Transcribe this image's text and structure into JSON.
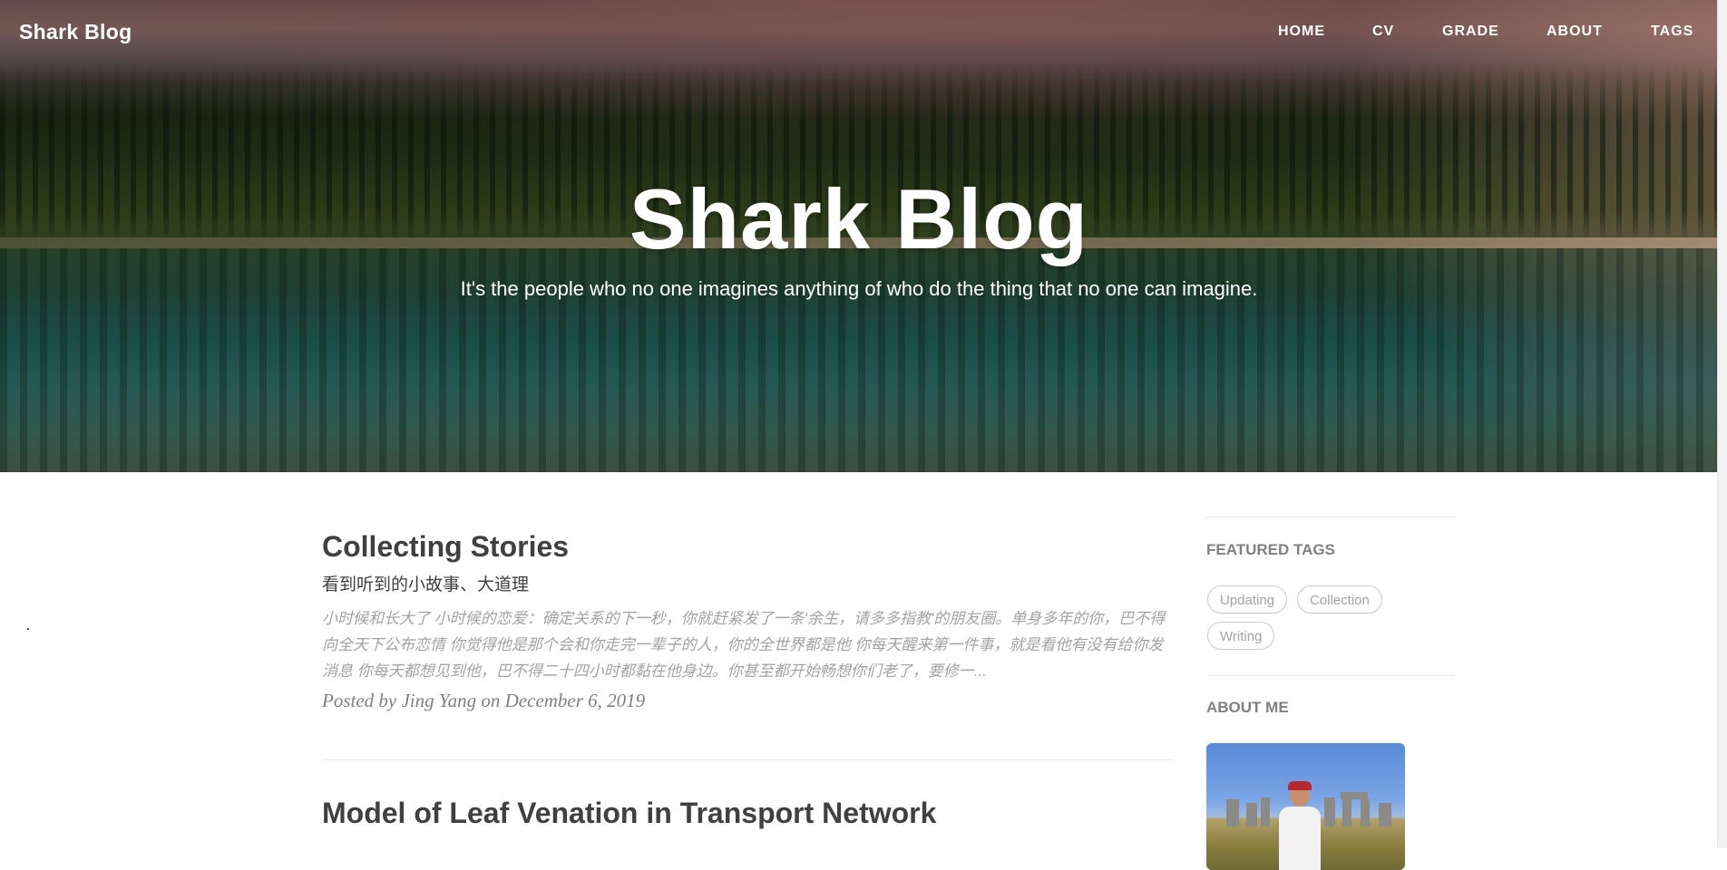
{
  "navbar": {
    "brand": "Shark Blog",
    "links": [
      "HOME",
      "CV",
      "GRADE",
      "ABOUT",
      "TAGS"
    ]
  },
  "hero": {
    "title": "Shark Blog",
    "subtitle": "It's the people who no one imagines anything of who do the thing that no one can imagine."
  },
  "posts": [
    {
      "title": "Collecting Stories",
      "subtitle": "看到听到的小故事、大道理",
      "excerpt": "小时候和长大了 小时候的恋爱：确定关系的下一秒，你就赶紧发了一条'余生，请多多指教'的朋友圈。单身多年的你，巴不得向全天下公布恋情 你觉得他是那个会和你走完一辈子的人，你的全世界都是他 你每天醒来第一件事，就是看他有没有给你发消息 你每天都想见到他，巴不得二十四小时都黏在他身边。你甚至都开始畅想你们老了，要修一...",
      "meta": "Posted by Jing Yang on December 6, 2019"
    },
    {
      "title": "Model of Leaf Venation in Transport Network"
    }
  ],
  "sidebar": {
    "featured_tags_heading": "FEATURED TAGS",
    "tags": [
      "Updating",
      "Collection",
      "Writing"
    ],
    "about_heading": "ABOUT ME",
    "avatar_icon": "profile-photo"
  },
  "colors": {
    "text_dark": "#404040",
    "text_muted": "#a3a3a3",
    "meta": "#808080",
    "tag_border": "#c9c9c9"
  }
}
